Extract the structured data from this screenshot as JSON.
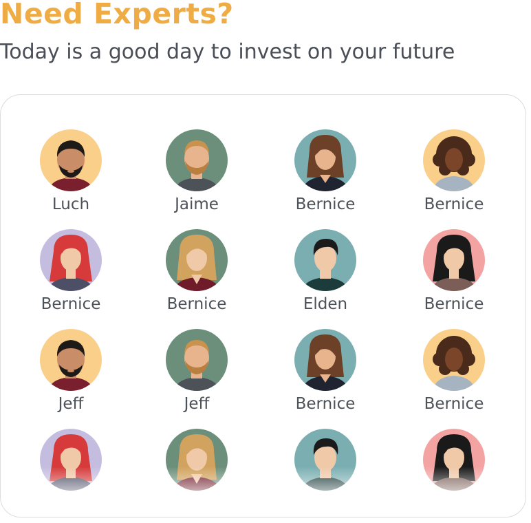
{
  "header": {
    "title": "Need Experts?",
    "subtitle": "Today is a good day to invest on your future"
  },
  "experts": [
    {
      "name": "Luch",
      "avatar": "man-beard-avatar-icon",
      "bg": "#f9cf8a"
    },
    {
      "name": "Jaime",
      "avatar": "man-blonde-beard-avatar-icon",
      "bg": "#6b8f7a"
    },
    {
      "name": "Bernice",
      "avatar": "woman-brown-hair-avatar-icon",
      "bg": "#7aaeb1"
    },
    {
      "name": "Bernice",
      "avatar": "woman-curly-hair-avatar-icon",
      "bg": "#f9cf8a"
    },
    {
      "name": "Bernice",
      "avatar": "woman-red-hair-avatar-icon",
      "bg": "#c5bde0"
    },
    {
      "name": "Bernice",
      "avatar": "woman-blonde-hair-avatar-icon",
      "bg": "#6b8f7a"
    },
    {
      "name": "Elden",
      "avatar": "man-dark-hair-avatar-icon",
      "bg": "#7aaeb1"
    },
    {
      "name": "Bernice",
      "avatar": "woman-black-hair-avatar-icon",
      "bg": "#f4a3a3"
    },
    {
      "name": "Jeff",
      "avatar": "man-beard-avatar-icon",
      "bg": "#f9cf8a"
    },
    {
      "name": "Jeff",
      "avatar": "man-blonde-beard-avatar-icon",
      "bg": "#6b8f7a"
    },
    {
      "name": "Bernice",
      "avatar": "woman-brown-hair-avatar-icon",
      "bg": "#7aaeb1"
    },
    {
      "name": "Bernice",
      "avatar": "woman-curly-hair-avatar-icon",
      "bg": "#f9cf8a"
    },
    {
      "name": "",
      "avatar": "woman-red-hair-avatar-icon",
      "bg": "#c5bde0"
    },
    {
      "name": "",
      "avatar": "woman-blonde-hair-avatar-icon",
      "bg": "#6b8f7a"
    },
    {
      "name": "",
      "avatar": "man-dark-hair-avatar-icon",
      "bg": "#7aaeb1"
    },
    {
      "name": "",
      "avatar": "woman-black-hair-avatar-icon",
      "bg": "#f4a3a3"
    }
  ],
  "colors": {
    "accent": "#f0ac44",
    "text": "#4d5259",
    "border": "#dcdcdc"
  }
}
